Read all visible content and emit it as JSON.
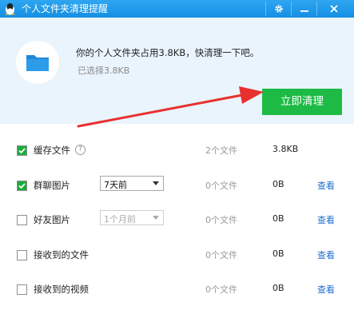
{
  "window": {
    "title": "个人文件夹清理提醒",
    "icon": "qq-penguin-icon",
    "controls": [
      "gear-icon",
      "minimize-icon",
      "close-icon"
    ]
  },
  "header": {
    "icon": "folder-icon",
    "headline": "你的个人文件夹占用3.8KB，快清理一下吧。",
    "selected": "已选择3.8KB",
    "clean_button": "立即清理"
  },
  "items": [
    {
      "label": "缓存文件",
      "checked": true,
      "help": "?",
      "count": "2个文件",
      "size": "3.8KB",
      "view": ""
    },
    {
      "label": "群聊图片",
      "checked": true,
      "select": "7天前",
      "count": "0个文件",
      "size": "0B",
      "view": "查看"
    },
    {
      "label": "好友图片",
      "checked": false,
      "select": "1个月前",
      "count": "0个文件",
      "size": "0B",
      "view": "查看"
    },
    {
      "label": "接收到的文件",
      "checked": false,
      "count": "0个文件",
      "size": "0B",
      "view": "查看"
    },
    {
      "label": "接收到的视频",
      "checked": false,
      "count": "0个文件",
      "size": "0B",
      "view": "查看"
    }
  ],
  "colors": {
    "titlebar": "#1a98e8",
    "header_bg": "#eaf4fc",
    "accent_green": "#1dbb45",
    "checkbox_green": "#1aad3b",
    "link_blue": "#1e6fd0",
    "annotation_red": "#e8312f"
  }
}
